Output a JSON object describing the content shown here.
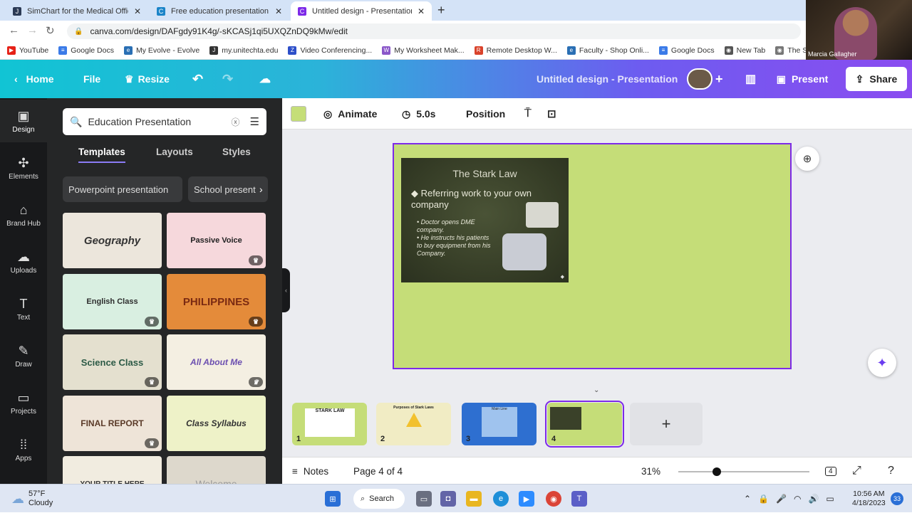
{
  "browser": {
    "tabs": [
      {
        "label": "SimChart for the Medical Office",
        "active": false
      },
      {
        "label": "Free education presentation tem",
        "active": false
      },
      {
        "label": "Untitled design - Presentation",
        "active": true
      }
    ],
    "new_tab": "+",
    "url": "canva.com/design/DAFgdy91K4g/-sKCASj1qi5UXQZnDQ9kMw/edit",
    "bookmarks": [
      "YouTube",
      "Google Docs",
      "My Evolve - Evolve",
      "my.unitechta.edu",
      "Video Conferencing...",
      "My Worksheet Mak...",
      "Remote Desktop W...",
      "Faculty - Shop Onli...",
      "Google Docs",
      "New Tab",
      "The Succe..."
    ]
  },
  "webcam": {
    "name": "Marcia Gallagher"
  },
  "header": {
    "home": "Home",
    "file": "File",
    "resize": "Resize",
    "title": "Untitled design - Presentation",
    "present": "Present",
    "share": "Share"
  },
  "rail": [
    {
      "label": "Design",
      "icon": "design-icon",
      "glyph": "▣"
    },
    {
      "label": "Elements",
      "icon": "elements-icon",
      "glyph": "✣"
    },
    {
      "label": "Brand Hub",
      "icon": "brand-icon",
      "glyph": "⌂"
    },
    {
      "label": "Uploads",
      "icon": "upload-icon",
      "glyph": "☁"
    },
    {
      "label": "Text",
      "icon": "text-icon",
      "glyph": "T"
    },
    {
      "label": "Draw",
      "icon": "draw-icon",
      "glyph": "✎"
    },
    {
      "label": "Projects",
      "icon": "folder-icon",
      "glyph": "▭"
    },
    {
      "label": "Apps",
      "icon": "apps-icon",
      "glyph": "⁞⁞"
    }
  ],
  "panel": {
    "search_value": "Education Presentation",
    "tabs": [
      "Templates",
      "Layouts",
      "Styles"
    ],
    "chips": [
      "Powerpoint presentation",
      "School present"
    ],
    "templates": [
      {
        "label": "Geography",
        "bg": "#ece6dc",
        "fg": "#333"
      },
      {
        "label": "Passive Voice",
        "bg": "#f6d8dc",
        "fg": "#222"
      },
      {
        "label": "English Class",
        "bg": "#d9efe1",
        "fg": "#2d2d2d"
      },
      {
        "label": "PHILIPPINES",
        "bg": "#e48b3a",
        "fg": "#7a2a12"
      },
      {
        "label": "Science Class",
        "bg": "#e4e0cf",
        "fg": "#2c5a46"
      },
      {
        "label": "All About Me",
        "bg": "#f4efe2",
        "fg": "#6c4fb0"
      },
      {
        "label": "FINAL REPORT",
        "bg": "#eee4d8",
        "fg": "#5a3a28"
      },
      {
        "label": "Class Syllabus",
        "bg": "#eef2c8",
        "fg": "#333"
      },
      {
        "label": "YOUR TITLE HERE",
        "bg": "#f1ece0",
        "fg": "#333"
      },
      {
        "label": "Welcome",
        "bg": "#ddd8cc",
        "fg": "#999"
      }
    ]
  },
  "toolbar": {
    "animate": "Animate",
    "duration": "5.0s",
    "position": "Position"
  },
  "slide": {
    "title": "The Stark Law",
    "bullet1": "Referring work to your own company",
    "sub1": "Doctor opens DME company.",
    "sub2": "He instructs his patients to buy equipment from his Company."
  },
  "pages": [
    {
      "num": "1",
      "bg": "#c5dd78",
      "label": "STARK LAW"
    },
    {
      "num": "2",
      "bg": "#f1ecc4",
      "label": "Purposes of Stark Laws"
    },
    {
      "num": "3",
      "bg": "#2e6fd0",
      "label": "Main Line"
    },
    {
      "num": "4",
      "bg": "#c5dd78",
      "label": ""
    }
  ],
  "footer": {
    "notes": "Notes",
    "page": "Page 4 of 4",
    "zoom": "31%",
    "pages_count": "4"
  },
  "taskbar": {
    "temp": "57°F",
    "weather": "Cloudy",
    "search": "Search",
    "time": "10:56 AM",
    "date": "4/18/2023",
    "notif": "33"
  }
}
